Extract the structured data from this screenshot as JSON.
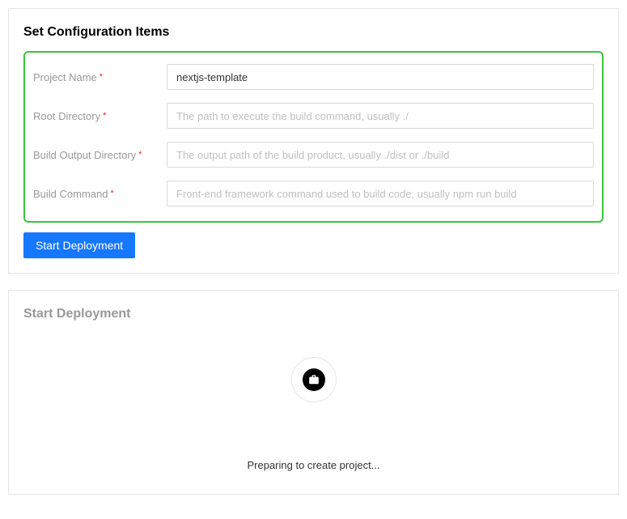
{
  "configPanel": {
    "title": "Set Configuration Items",
    "fields": {
      "projectName": {
        "label": "Project Name",
        "value": "nextjs-template",
        "placeholder": ""
      },
      "rootDirectory": {
        "label": "Root Directory",
        "value": "",
        "placeholder": "The path to execute the build command, usually ./"
      },
      "buildOutputDirectory": {
        "label": "Build Output Directory",
        "value": "",
        "placeholder": "The output path of the build product, usually ./dist or ./build"
      },
      "buildCommand": {
        "label": "Build Command",
        "value": "",
        "placeholder": "Front-end framework command used to build code, usually npm run build"
      }
    },
    "submitLabel": "Start Deployment"
  },
  "deployPanel": {
    "title": "Start Deployment",
    "statusText": "Preparing to create project..."
  }
}
